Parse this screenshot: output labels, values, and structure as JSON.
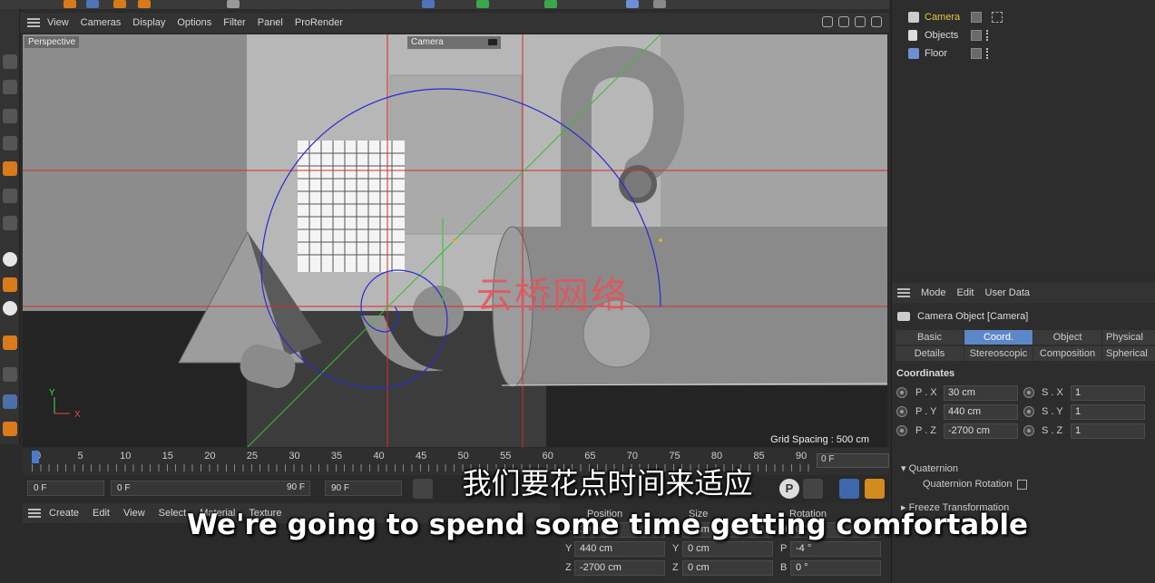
{
  "viewport_menu": [
    "View",
    "Cameras",
    "Display",
    "Options",
    "Filter",
    "Panel",
    "ProRender"
  ],
  "viewport": {
    "view_name": "Perspective",
    "camera_label": "Camera",
    "grid_spacing": "Grid Spacing : 500 cm",
    "watermark": "云桥网络",
    "axis_x": "X",
    "axis_y": "Y"
  },
  "timeline": {
    "ticks": [
      "0",
      "5",
      "10",
      "15",
      "20",
      "25",
      "30",
      "35",
      "40",
      "45",
      "50",
      "55",
      "60",
      "65",
      "70",
      "75",
      "80",
      "85",
      "90"
    ],
    "current_frame": "0 F"
  },
  "playback": {
    "start": "0 F",
    "min": "0 F",
    "max": "90 F",
    "end": "90 F"
  },
  "material_menu": [
    "Create",
    "Edit",
    "View",
    "Select",
    "Material",
    "Texture"
  ],
  "coordinates_manager": {
    "headers": [
      "Position",
      "Size",
      "Rotation"
    ],
    "rows": [
      {
        "axis": "X",
        "position": "30 cm",
        "size_axis": "X",
        "size": "0 cm",
        "rot_axis": "H",
        "rotation": "0 °"
      },
      {
        "axis": "Y",
        "position": "440 cm",
        "size_axis": "Y",
        "size": "0 cm",
        "rot_axis": "P",
        "rotation": "-4 °"
      },
      {
        "axis": "Z",
        "position": "-2700 cm",
        "size_axis": "Z",
        "size": "0 cm",
        "rot_axis": "B",
        "rotation": "0 °"
      }
    ]
  },
  "object_manager": {
    "objects": [
      {
        "name": "Camera",
        "color": "#e8c640"
      },
      {
        "name": "Objects",
        "color": "#dddddd"
      },
      {
        "name": "Floor",
        "color": "#6e8fd4"
      }
    ]
  },
  "attributes": {
    "menu": [
      "Mode",
      "Edit",
      "User Data"
    ],
    "title": "Camera Object [Camera]",
    "tabs_row1": [
      "Basic",
      "Coord.",
      "Object",
      "Physical"
    ],
    "tabs_row2": [
      "Details",
      "Stereoscopic",
      "Composition",
      "Spherical"
    ],
    "active_tab": "Coord.",
    "section": "Coordinates",
    "coords": [
      {
        "p_label": "P . X",
        "p_value": "30 cm",
        "s_label": "S . X",
        "s_value": "1"
      },
      {
        "p_label": "P . Y",
        "p_value": "440 cm",
        "s_label": "S . Y",
        "s_value": "1"
      },
      {
        "p_label": "P . Z",
        "p_value": "-2700 cm",
        "s_label": "S . Z",
        "s_value": "1"
      }
    ],
    "quaternion_head": "Quaternion",
    "quaternion_rotation": "Quaternion Rotation",
    "freeze_head": "Freeze Transformation"
  },
  "subtitles": {
    "chinese": "我们要花点时间来适应",
    "english": "We're going to spend some time getting comfortable"
  },
  "colors": {
    "accent_blue": "#5d87c9",
    "guide_red": "#d82a2a",
    "spiral_blue": "#2a2ad0",
    "guide_green": "#35c035"
  }
}
